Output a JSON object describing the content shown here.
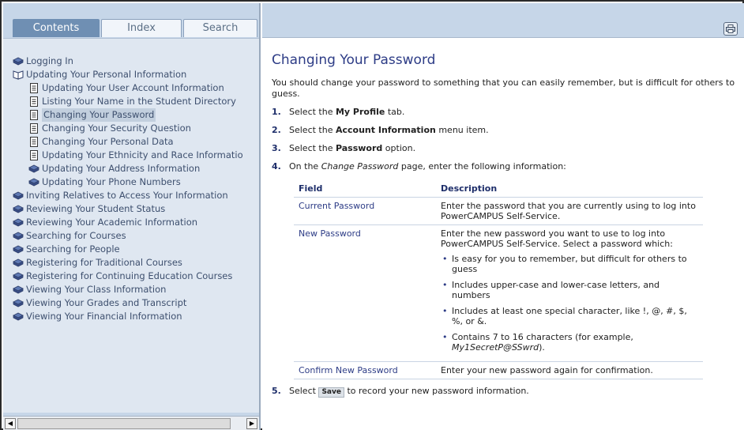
{
  "tabs": [
    "Contents",
    "Index",
    "Search"
  ],
  "tree": [
    {
      "label": "Logging In",
      "icon": "book-closed-icon",
      "indent": false,
      "selected": false
    },
    {
      "label": "Updating Your Personal Information",
      "icon": "book-open-icon",
      "indent": false,
      "selected": false
    },
    {
      "label": "Updating Your User Account Information",
      "icon": "page-icon",
      "indent": true,
      "selected": false
    },
    {
      "label": "Listing Your Name in the Student Directory",
      "icon": "page-icon",
      "indent": true,
      "selected": false
    },
    {
      "label": "Changing Your Password",
      "icon": "page-icon",
      "indent": true,
      "selected": true
    },
    {
      "label": "Changing Your Security Question",
      "icon": "page-icon",
      "indent": true,
      "selected": false
    },
    {
      "label": "Changing Your Personal Data",
      "icon": "page-icon",
      "indent": true,
      "selected": false
    },
    {
      "label": "Updating Your Ethnicity and Race Informatio",
      "icon": "page-icon",
      "indent": true,
      "selected": false
    },
    {
      "label": "Updating Your Address Information",
      "icon": "book-closed-icon",
      "indent": true,
      "selected": false
    },
    {
      "label": "Updating Your Phone Numbers",
      "icon": "book-closed-icon",
      "indent": true,
      "selected": false
    },
    {
      "label": "Inviting Relatives to Access Your Information",
      "icon": "book-closed-icon",
      "indent": false,
      "selected": false
    },
    {
      "label": "Reviewing Your Student Status",
      "icon": "book-closed-icon",
      "indent": false,
      "selected": false
    },
    {
      "label": "Reviewing Your Academic Information",
      "icon": "book-closed-icon",
      "indent": false,
      "selected": false
    },
    {
      "label": "Searching for Courses",
      "icon": "book-closed-icon",
      "indent": false,
      "selected": false
    },
    {
      "label": "Searching for People",
      "icon": "book-closed-icon",
      "indent": false,
      "selected": false
    },
    {
      "label": "Registering for Traditional Courses",
      "icon": "book-closed-icon",
      "indent": false,
      "selected": false
    },
    {
      "label": "Registering for Continuing Education Courses",
      "icon": "book-closed-icon",
      "indent": false,
      "selected": false
    },
    {
      "label": "Viewing Your Class Information",
      "icon": "book-closed-icon",
      "indent": false,
      "selected": false
    },
    {
      "label": "Viewing Your Grades and Transcript",
      "icon": "book-closed-icon",
      "indent": false,
      "selected": false
    },
    {
      "label": "Viewing Your Financial Information",
      "icon": "book-closed-icon",
      "indent": false,
      "selected": false
    }
  ],
  "article": {
    "title": "Changing Your Password",
    "intro": "You should change your password to something that you can easily remember, but is difficult for others to guess.",
    "steps": [
      {
        "num": "1.",
        "pre": "Select the ",
        "bold": "My Profile",
        "post": " tab."
      },
      {
        "num": "2.",
        "pre": "Select the ",
        "bold": "Account Information",
        "post": " menu item."
      },
      {
        "num": "3.",
        "pre": "Select the ",
        "bold": "Password",
        "post": " option."
      },
      {
        "num": "4.",
        "pre": "On the ",
        "italic": "Change Password",
        "post": " page, enter the following information:"
      }
    ],
    "table": {
      "headers": [
        "Field",
        "Description"
      ],
      "rows": [
        {
          "field": "Current Password",
          "desc": "Enter the password that you are currently using to log into PowerCAMPUS Self-Service."
        },
        {
          "field": "New Password",
          "desc": "Enter the new password you want to use to log into PowerCAMPUS Self-Service. Select a password which:",
          "bullets": [
            "Is easy for you to remember, but difficult for others to guess",
            "Includes upper-case and lower-case letters, and numbers",
            "Includes at least one special character, like !, @, #, $, %, or &.",
            "Contains 7 to 16 characters (for example, "
          ],
          "example": "My1SecretP@SSwrd",
          "example_suffix": ")."
        },
        {
          "field": "Confirm New Password",
          "desc": "Enter your new password again for confirmation."
        }
      ]
    },
    "step5": {
      "num": "5.",
      "pre": "Select ",
      "chip": "Save",
      "post": " to record your new password information."
    }
  }
}
